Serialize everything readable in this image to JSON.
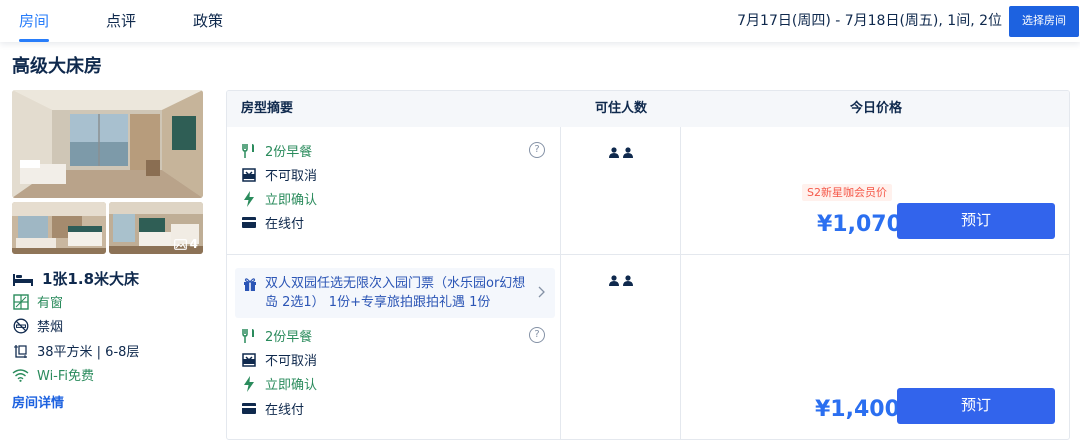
{
  "nav": {
    "tabs": [
      {
        "label": "房间",
        "active": true
      },
      {
        "label": "点评",
        "active": false
      },
      {
        "label": "政策",
        "active": false
      }
    ],
    "date_summary": "7月17日(周四) - 7月18日(周五), 1间, 2位",
    "select_room_button": "选择房间"
  },
  "room": {
    "title": "高级大床房",
    "photo_count": "4",
    "bed": "1张1.8米大床",
    "window": "有窗",
    "smoking": "禁烟",
    "area_floor": "38平方米 | 6-8层",
    "wifi": "Wi-Fi免费",
    "detail_link": "房间详情"
  },
  "table": {
    "headers": {
      "summary": "房型摘要",
      "occupancy": "可住人数",
      "price": "今日价格"
    },
    "rates": [
      {
        "package": null,
        "perks": [
          {
            "icon": "fork-knife-icon",
            "label": "2份早餐",
            "green": true
          },
          {
            "icon": "no-cancel-icon",
            "label": "不可取消",
            "green": false
          },
          {
            "icon": "lightning-icon",
            "label": "立即确认",
            "green": true
          },
          {
            "icon": "card-icon",
            "label": "在线付",
            "green": false
          }
        ],
        "help": "?",
        "guests": 2,
        "member_tag": "S2新星咖会员价",
        "price": "¥1,070",
        "book_label": "预订"
      },
      {
        "package": "双人双园任选无限次入园门票（水乐园or幻想岛 2选1） 1份+专享旅拍跟拍礼遇 1份",
        "perks": [
          {
            "icon": "fork-knife-icon",
            "label": "2份早餐",
            "green": true
          },
          {
            "icon": "no-cancel-icon",
            "label": "不可取消",
            "green": false
          },
          {
            "icon": "lightning-icon",
            "label": "立即确认",
            "green": true
          },
          {
            "icon": "card-icon",
            "label": "在线付",
            "green": false
          }
        ],
        "help": "?",
        "guests": 2,
        "member_tag": null,
        "price": "¥1,400",
        "book_label": "预订"
      }
    ]
  },
  "colors": {
    "brand_blue": "#287dfa",
    "button_blue": "#3264ec",
    "green": "#2a8b5c",
    "text": "#0f294d",
    "member_tag": "#f5594a"
  }
}
